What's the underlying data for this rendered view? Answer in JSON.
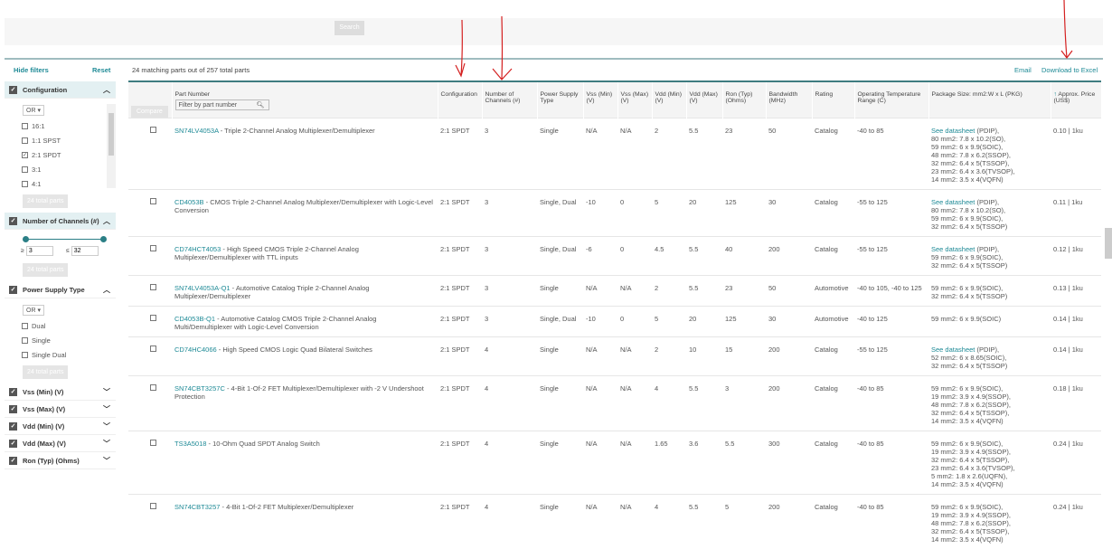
{
  "top": {
    "search_label": "Search"
  },
  "header": {
    "hide_filters": "Hide filters",
    "reset": "Reset",
    "count": "24 matching parts out of 257 total parts",
    "email": "Email",
    "download": "Download to Excel"
  },
  "filters": {
    "configuration": {
      "title": "Configuration",
      "op": "OR",
      "options": [
        {
          "label": "16:1",
          "checked": false
        },
        {
          "label": "1:1 SPST",
          "checked": false
        },
        {
          "label": "2:1 SPDT",
          "checked": true
        },
        {
          "label": "3:1",
          "checked": false
        },
        {
          "label": "4:1",
          "checked": false
        }
      ],
      "total": "24 total parts"
    },
    "channels": {
      "title": "Number of Channels (#)",
      "min_sym": "≥",
      "max_sym": "≤",
      "min": "3",
      "max": "32",
      "total": "24 total parts"
    },
    "power": {
      "title": "Power Supply Type",
      "op": "OR",
      "options": [
        {
          "label": "Dual"
        },
        {
          "label": "Single"
        },
        {
          "label": "Single Dual"
        }
      ],
      "total": "24 total parts"
    },
    "collapsed": [
      "Vss (Min) (V)",
      "Vss (Max) (V)",
      "Vdd (Min) (V)",
      "Vdd (Max) (V)",
      "Ron (Typ) (Ohms)"
    ]
  },
  "table": {
    "compare": "Compare",
    "part_header": "Part Number",
    "filter_placeholder": "Filter by part number",
    "columns": [
      "Configuration",
      "Number of Channels (#)",
      "Power Supply Type",
      "Vss (Min) (V)",
      "Vss (Max) (V)",
      "Vdd (Min) (V)",
      "Vdd (Max) (V)",
      "Ron (Typ) (Ohms)",
      "Bandwidth (MHz)",
      "Rating",
      "Operating Temperature Range (C)",
      "Package Size: mm2:W x L (PKG)",
      "Approx. Price (US$)"
    ],
    "sort_icon": "arrow-up-icon",
    "rows": [
      {
        "part": "SN74LV4053A",
        "desc": " - Triple 2-Channel Analog Multiplexer/Demultiplexer",
        "cells": [
          "2:1 SPDT",
          "3",
          "Single",
          "N/A",
          "N/A",
          "2",
          "5.5",
          "23",
          "50",
          "Catalog",
          "-40 to 85"
        ],
        "ds": "See datasheet",
        "pkg": " (PDIP),\n80 mm2: 7.8 x 10.2(SO),\n59 mm2: 6 x 9.9(SOIC),\n48 mm2: 7.8 x 6.2(SSOP),\n32 mm2: 6.4 x 5(TSSOP),\n23 mm2: 6.4 x 3.6(TVSOP),\n14 mm2: 3.5 x 4(VQFN)",
        "price": "0.10 | 1ku"
      },
      {
        "part": "CD4053B",
        "desc": " - CMOS Triple 2-Channel Analog Multiplexer/Demultiplexer with Logic-Level Conversion",
        "cells": [
          "2:1 SPDT",
          "3",
          "Single, Dual",
          "-10",
          "0",
          "5",
          "20",
          "125",
          "30",
          "Catalog",
          "-55 to 125"
        ],
        "ds": "See datasheet",
        "pkg": " (PDIP),\n80 mm2: 7.8 x 10.2(SO),\n59 mm2: 6 x 9.9(SOIC),\n32 mm2: 6.4 x 5(TSSOP)",
        "price": "0.11 | 1ku"
      },
      {
        "part": "CD74HCT4053",
        "desc": " - High Speed CMOS Triple 2-Channel Analog Multiplexer/Demultiplexer with TTL inputs",
        "cells": [
          "2:1 SPDT",
          "3",
          "Single, Dual",
          "-6",
          "0",
          "4.5",
          "5.5",
          "40",
          "200",
          "Catalog",
          "-55 to 125"
        ],
        "ds": "See datasheet",
        "pkg": " (PDIP),\n59 mm2: 6 x 9.9(SOIC),\n32 mm2: 6.4 x 5(TSSOP)",
        "price": "0.12 | 1ku"
      },
      {
        "part": "SN74LV4053A-Q1",
        "desc": " - Automotive Catalog Triple 2-Channel Analog Multiplexer/Demultiplexer",
        "cells": [
          "2:1 SPDT",
          "3",
          "Single",
          "N/A",
          "N/A",
          "2",
          "5.5",
          "23",
          "50",
          "Automotive",
          "-40 to 105, -40 to 125"
        ],
        "ds": "",
        "pkg": "59 mm2: 6 x 9.9(SOIC),\n32 mm2: 6.4 x 5(TSSOP)",
        "price": "0.13 | 1ku"
      },
      {
        "part": "CD4053B-Q1",
        "desc": " - Automotive Catalog CMOS Triple 2-Channel Analog Multi/Demultiplexer with Logic-Level Conversion",
        "cells": [
          "2:1 SPDT",
          "3",
          "Single, Dual",
          "-10",
          "0",
          "5",
          "20",
          "125",
          "30",
          "Automotive",
          "-40 to 125"
        ],
        "ds": "",
        "pkg": "59 mm2: 6 x 9.9(SOIC)",
        "price": "0.14 | 1ku"
      },
      {
        "part": "CD74HC4066",
        "desc": " - High Speed CMOS Logic Quad Bilateral Switches",
        "cells": [
          "2:1 SPDT",
          "4",
          "Single",
          "N/A",
          "N/A",
          "2",
          "10",
          "15",
          "200",
          "Catalog",
          "-55 to 125"
        ],
        "ds": "See datasheet",
        "pkg": " (PDIP),\n52 mm2: 6 x 8.65(SOIC),\n32 mm2: 6.4 x 5(TSSOP)",
        "price": "0.14 | 1ku"
      },
      {
        "part": "SN74CBT3257C",
        "desc": " - 4-Bit 1-Of-2 FET Multiplexer/Demultiplexer with -2 V Undershoot Protection",
        "cells": [
          "2:1 SPDT",
          "4",
          "Single",
          "N/A",
          "N/A",
          "4",
          "5.5",
          "3",
          "200",
          "Catalog",
          "-40 to 85"
        ],
        "ds": "",
        "pkg": "59 mm2: 6 x 9.9(SOIC),\n19 mm2: 3.9 x 4.9(SSOP),\n48 mm2: 7.8 x 6.2(SSOP),\n32 mm2: 6.4 x 5(TSSOP),\n14 mm2: 3.5 x 4(VQFN)",
        "price": "0.18 | 1ku"
      },
      {
        "part": "TS3A5018",
        "desc": " - 10-Ohm Quad SPDT Analog Switch",
        "cells": [
          "2:1 SPDT",
          "4",
          "Single",
          "N/A",
          "N/A",
          "1.65",
          "3.6",
          "5.5",
          "300",
          "Catalog",
          "-40 to 85"
        ],
        "ds": "",
        "pkg": "59 mm2: 6 x 9.9(SOIC),\n19 mm2: 3.9 x 4.9(SSOP),\n32 mm2: 6.4 x 5(TSSOP),\n23 mm2: 6.4 x 3.6(TVSOP),\n5 mm2: 1.8 x 2.6(UQFN),\n14 mm2: 3.5 x 4(VQFN)",
        "price": "0.24 | 1ku"
      },
      {
        "part": "SN74CBT3257",
        "desc": " - 4-Bit 1-Of-2 FET Multiplexer/Demultiplexer",
        "cells": [
          "2:1 SPDT",
          "4",
          "Single",
          "N/A",
          "N/A",
          "4",
          "5.5",
          "5",
          "200",
          "Catalog",
          "-40 to 85"
        ],
        "ds": "",
        "pkg": "59 mm2: 6 x 9.9(SOIC),\n19 mm2: 3.9 x 4.9(SSOP),\n48 mm2: 7.8 x 6.2(SSOP),\n32 mm2: 6.4 x 5(TSSOP),\n14 mm2: 3.5 x 4(VQFN)",
        "price": "0.24 | 1ku"
      }
    ]
  },
  "colors": {
    "accent": "#1e8a96",
    "annotation": "#d42020"
  }
}
